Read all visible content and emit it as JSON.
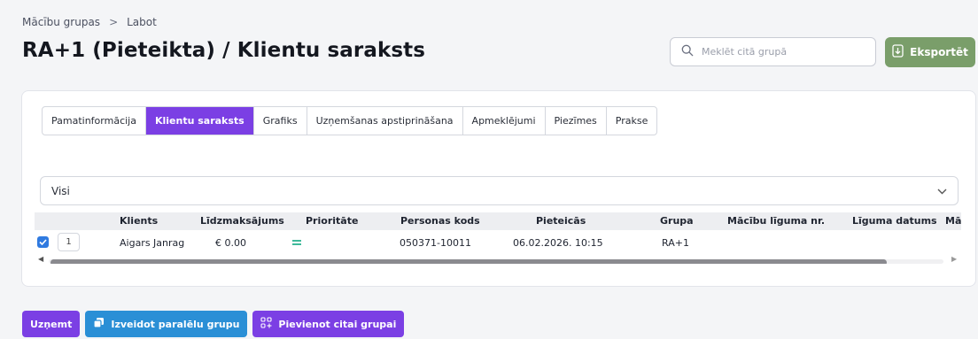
{
  "breadcrumb": {
    "parent": "Mācību grupas",
    "separator": ">",
    "current": "Labot"
  },
  "page": {
    "title": "RA+1 (Pieteikta) / Klientu saraksts"
  },
  "search": {
    "placeholder": "Meklēt citā grupā",
    "icon": "search-icon"
  },
  "export": {
    "label": "Eksportēt",
    "icon": "file-export-icon",
    "color": "#7a9e6a"
  },
  "tabs": [
    {
      "label": "Pamatinformācija",
      "active": false
    },
    {
      "label": "Klientu saraksts",
      "active": true
    },
    {
      "label": "Grafiks",
      "active": false
    },
    {
      "label": "Uzņemšanas apstiprināšana",
      "active": false
    },
    {
      "label": "Apmeklējumi",
      "active": false
    },
    {
      "label": "Piezīmes",
      "active": false
    },
    {
      "label": "Prakse",
      "active": false
    }
  ],
  "filter": {
    "value": "Visi",
    "icon": "chevron-down-icon"
  },
  "table": {
    "columns": [
      "Klients",
      "Līdzmaksājums",
      "Prioritāte",
      "Personas kods",
      "Pieteicās",
      "Grupa",
      "Mācību līguma nr.",
      "Līguma datums",
      "Mācīl"
    ],
    "rows": [
      {
        "checked": true,
        "number": "1",
        "client": "Aigars Janrag",
        "copay": "€ 0.00",
        "priority_icon": "equals-priority-icon",
        "personal_code": "050371-10011",
        "applied": "06.02.2026. 10:15",
        "group": "RA+1"
      }
    ]
  },
  "actions": {
    "admit": "Uzņemt",
    "parallel": {
      "label": "Izveidot paralēlu grupu",
      "icon": "copy-icon"
    },
    "add_to_group": {
      "label": "Pievienot citai grupai",
      "icon": "grid-plus-icon"
    }
  },
  "colors": {
    "accent": "#7b3fe4",
    "blue": "#2a8fd6",
    "green": "#7a9e6a",
    "checkbox": "#2f7ae0",
    "priority": "#3fb99a"
  }
}
